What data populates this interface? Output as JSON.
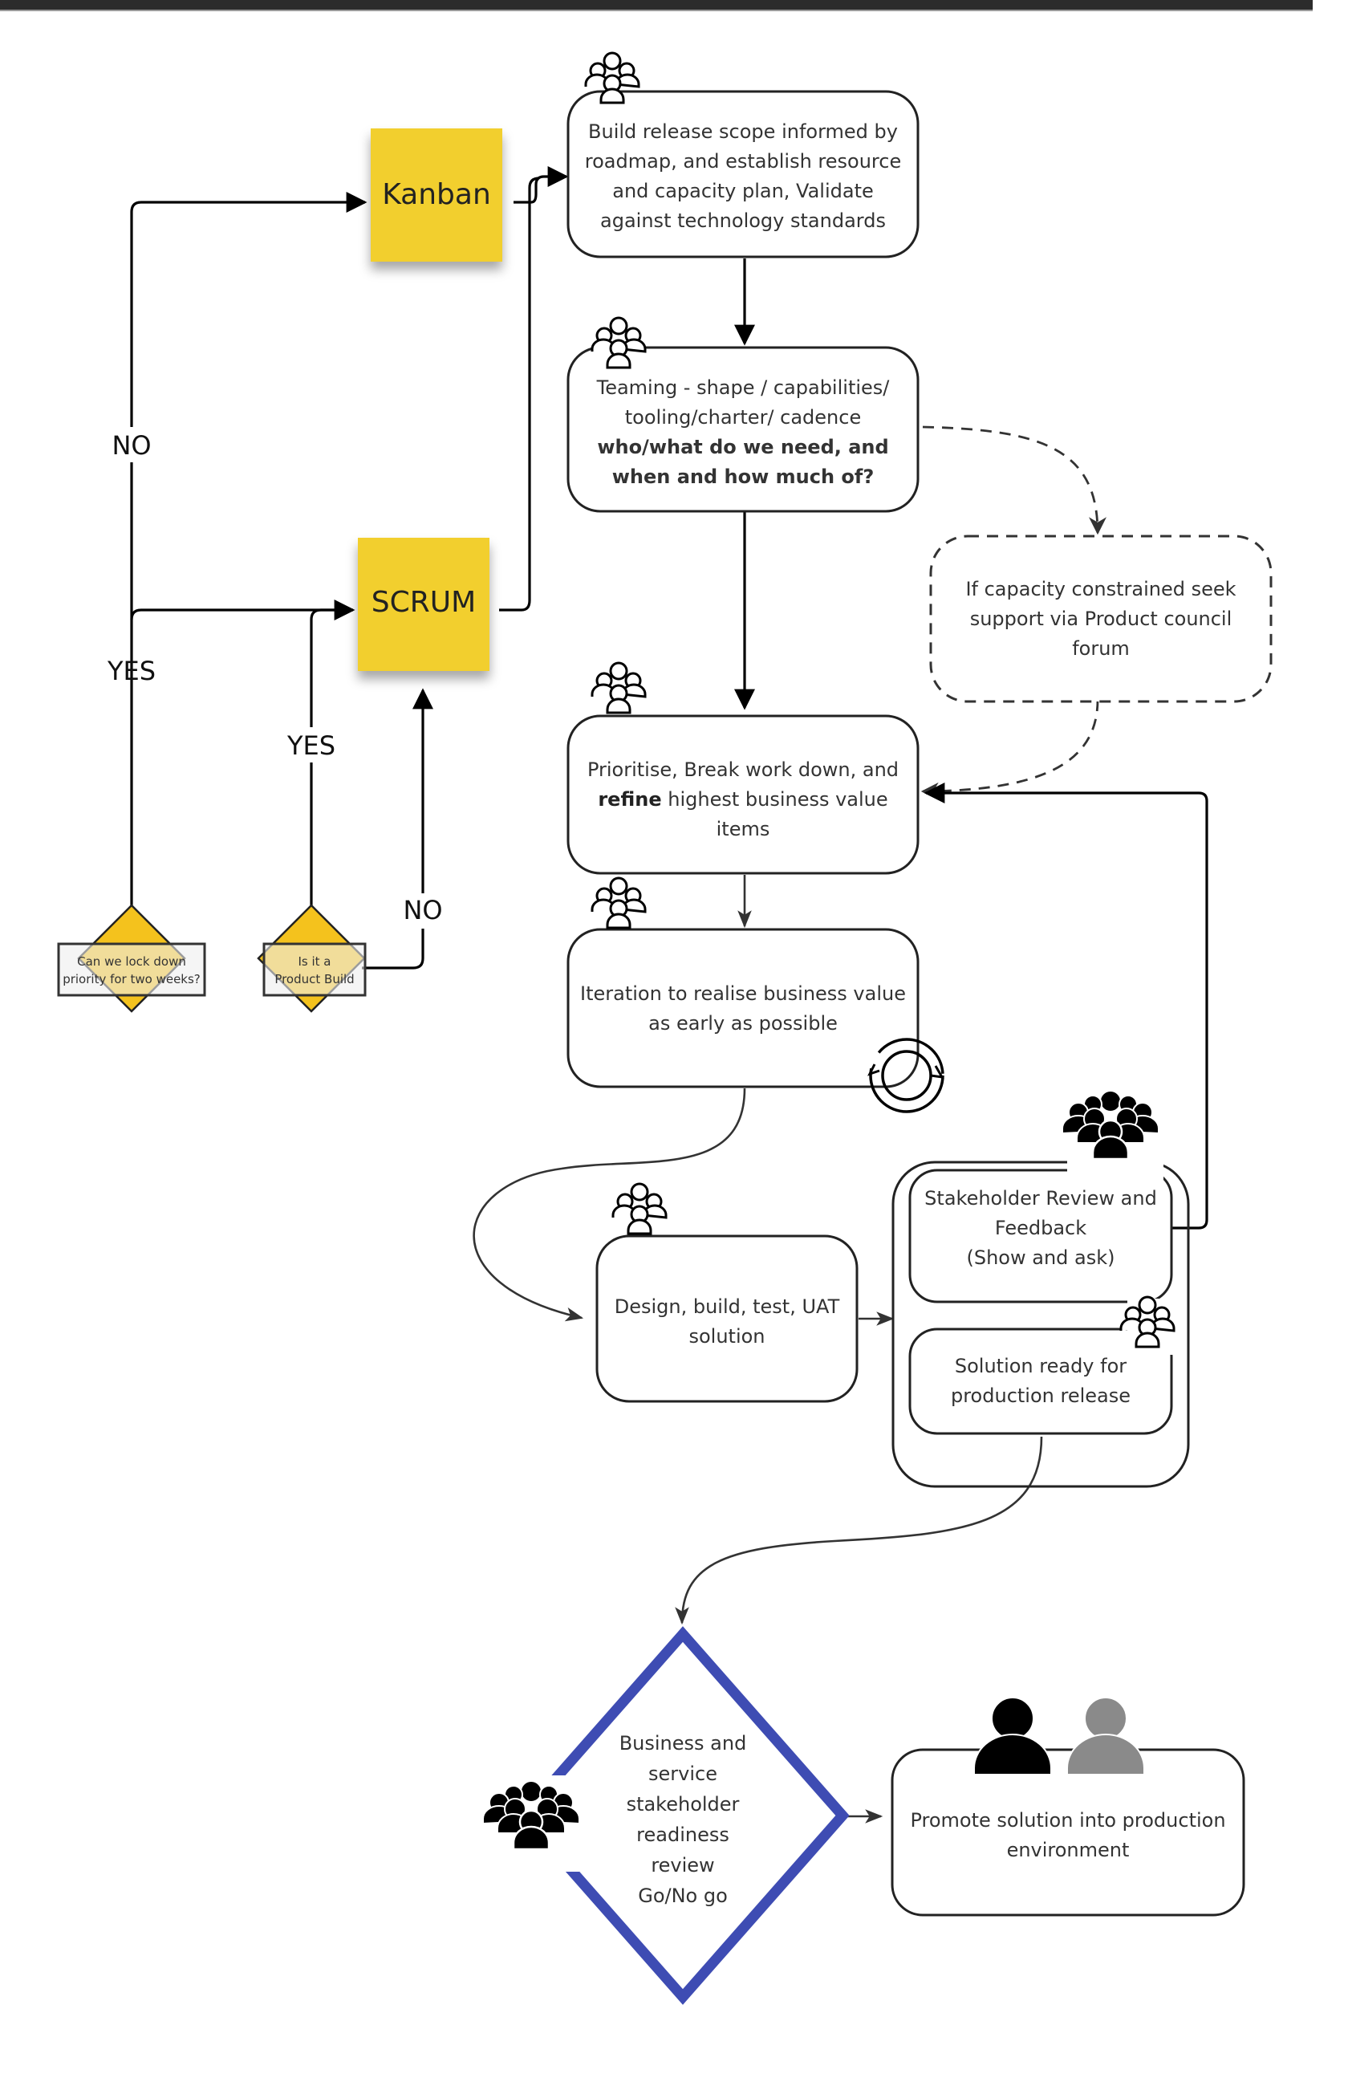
{
  "header": {
    "bar": "dark-top-banner"
  },
  "colors": {
    "sticky": "#f2cf2e",
    "decision_fill": "#f4c21d",
    "decision_label_bg": "#eeeeee",
    "gate_stroke": "#3e4cb3",
    "person_gray": "#8a8a8a",
    "line": "#222222"
  },
  "stickies": {
    "kanban": "Kanban",
    "scrum": "SCRUM"
  },
  "decisions": {
    "lock_priority": [
      "Can we lock down",
      "priority for two weeks?"
    ],
    "product_build": [
      "Is it a",
      "Product Build"
    ]
  },
  "edge_labels": {
    "no_to_kanban": "NO",
    "yes_to_scrum": "YES",
    "yes_product_build": "YES",
    "no_product_build": "NO"
  },
  "steps": {
    "release_scope": {
      "lines": [
        "Build release scope informed by",
        "roadmap, and establish resource",
        "and capacity plan, Validate",
        "against technology standards"
      ],
      "icon": "team-outline-icon"
    },
    "teaming": {
      "lines": [
        "Teaming -  shape / capabilities/",
        "tooling/charter/ cadence"
      ],
      "bold_lines": [
        "who/what do we need,  and",
        "when and how much of?"
      ],
      "icon": "team-outline-icon"
    },
    "capacity": {
      "lines": [
        "If  capacity constrained seek",
        "support via Product council",
        "forum"
      ]
    },
    "prioritise": {
      "line1": "Prioritise, Break work down,  and",
      "line2_bold": "refine",
      "line2_rest": " highest business value",
      "line3": "items",
      "icon": "team-outline-icon"
    },
    "iteration": {
      "lines": [
        "Iteration to realise business value",
        "as early as possible"
      ],
      "icon": "team-outline-icon",
      "badge": "cycle-icon"
    },
    "design_build": {
      "lines": [
        "Design, build, test, UAT",
        "solution"
      ],
      "icon": "team-outline-icon"
    },
    "stakeholder_review": {
      "lines": [
        "Stakeholder Review and",
        "Feedback",
        "(Show and ask)"
      ],
      "icon": "crowd-solid-icon"
    },
    "solution_ready": {
      "lines": [
        "Solution ready for",
        "production release"
      ],
      "icon": "team-outline-icon"
    },
    "readiness_gate": {
      "lines": [
        "Business and",
        "service",
        "stakeholder",
        "readiness",
        "review",
        "Go/No go"
      ],
      "icon": "crowd-solid-icon"
    },
    "promote": {
      "lines": [
        "Promote solution into production",
        "environment"
      ],
      "icons": [
        "person-solid-icon",
        "person-gray-icon"
      ]
    }
  }
}
